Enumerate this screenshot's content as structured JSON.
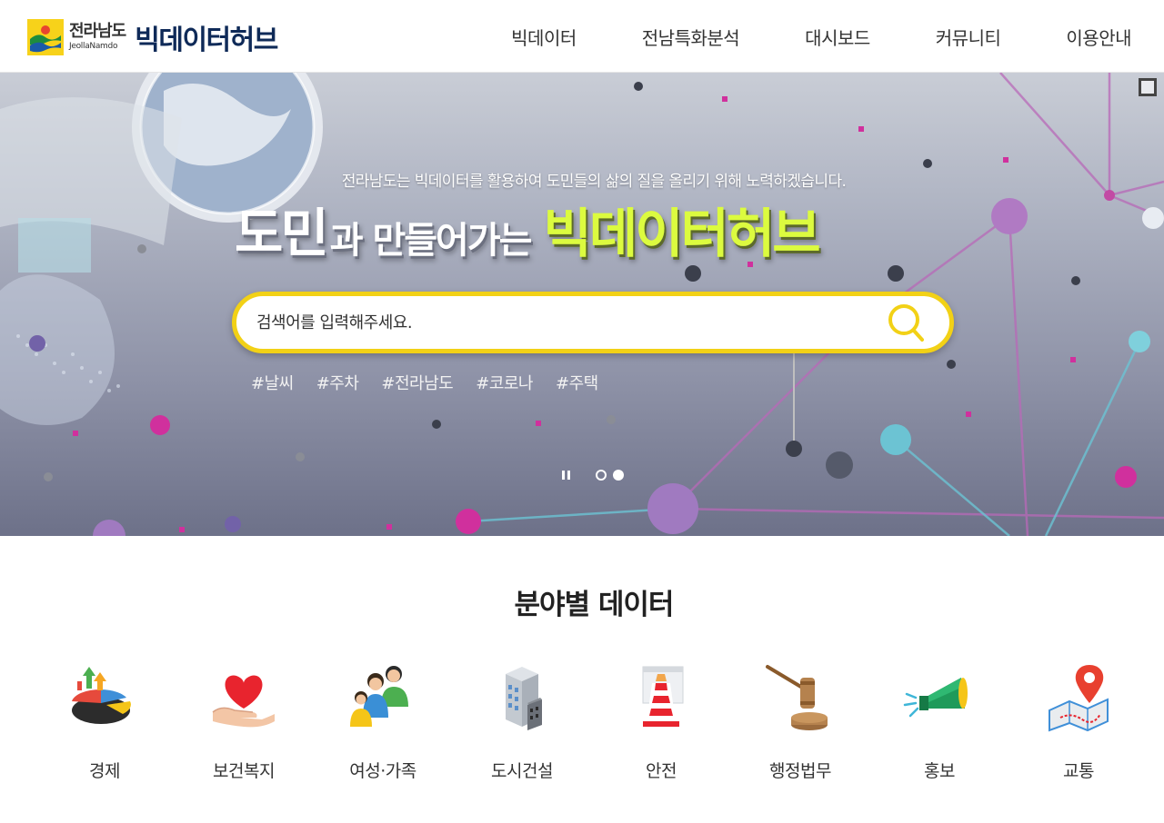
{
  "brand": {
    "logo_kr": "전라남도",
    "logo_en": "JeollaNamdo",
    "site_title": "빅데이터허브"
  },
  "nav": {
    "items": [
      "빅데이터",
      "전남특화분석",
      "대시보드",
      "커뮤니티",
      "이용안내"
    ]
  },
  "hero": {
    "subtitle": "전라남도는 빅데이터를 활용하여 도민들의 삶의 질을 올리기 위해 노력하겠습니다.",
    "title_part1": "도민",
    "title_part2": "과 만들어가는",
    "title_part3": "빅데이터허브",
    "search_placeholder": "검색어를 입력해주세요.",
    "tags": [
      "#날씨",
      "#주차",
      "#전라남도",
      "#코로나",
      "#주택"
    ],
    "slides_total": 2,
    "slide_active": 2
  },
  "section": {
    "title": "분야별 데이터",
    "categories": [
      {
        "label": "경제",
        "icon": "economy-chart-icon"
      },
      {
        "label": "보건복지",
        "icon": "heart-hand-icon"
      },
      {
        "label": "여성·가족",
        "icon": "family-icon"
      },
      {
        "label": "도시건설",
        "icon": "building-icon"
      },
      {
        "label": "안전",
        "icon": "safety-cone-icon"
      },
      {
        "label": "행정법무",
        "icon": "gavel-icon"
      },
      {
        "label": "홍보",
        "icon": "megaphone-icon"
      },
      {
        "label": "교통",
        "icon": "map-pin-icon"
      }
    ]
  },
  "colors": {
    "accent_yellow": "#f2d116",
    "title_green": "#dcfb3f",
    "navy": "#0f2a58"
  }
}
